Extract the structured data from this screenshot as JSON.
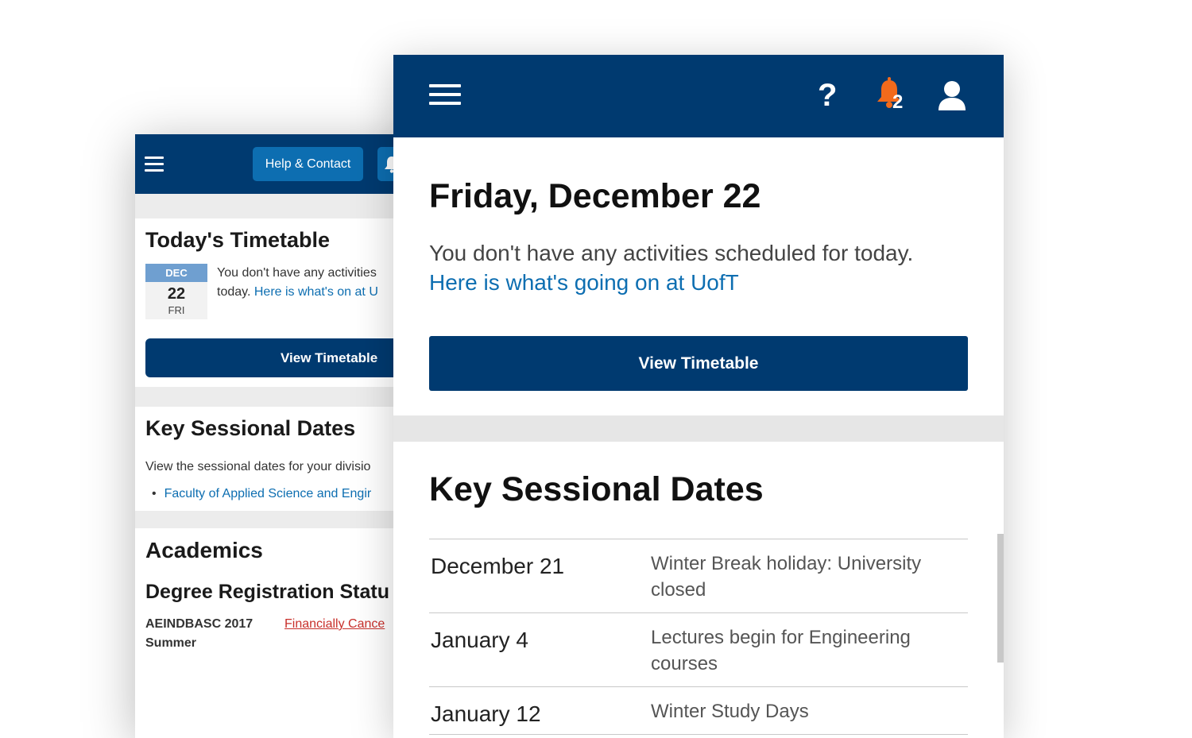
{
  "back_panel": {
    "header": {
      "help_label": "Help & Contact",
      "icons": [
        "menu-icon",
        "bell-icon"
      ]
    },
    "timetable": {
      "title": "Today's Timetable",
      "date": {
        "month": "DEC",
        "day": "22",
        "weekday": "FRI"
      },
      "message_line1": "You don't have any activities",
      "message_line2_prefix": "today.",
      "link": "Here is what's on at U",
      "button": "View Timetable"
    },
    "sessional": {
      "title": "Key Sessional Dates",
      "subtitle": "View the sessional dates for your divisio",
      "link": "Faculty of Applied Science and Engir"
    },
    "academics": {
      "title": "Academics",
      "subtitle": "Degree Registration Statu",
      "program_line1": "AEINDBASC 2017",
      "program_line2": "Summer",
      "status": "Financially Cance"
    }
  },
  "front_panel": {
    "header": {
      "help_label": "?",
      "notification_count": "2",
      "icons": [
        "menu-icon",
        "help-icon",
        "bell-icon",
        "user-icon"
      ],
      "bell_color": "#f26a1b"
    },
    "today": {
      "date_title": "Friday, December 22",
      "message": "You don't have any activities scheduled for today.",
      "link": "Here is what's going on at UofT",
      "button": "View Timetable"
    },
    "sessional": {
      "title": "Key Sessional Dates",
      "rows": [
        {
          "date": "December 21",
          "event": "Winter Break holiday: University closed"
        },
        {
          "date": "January 4",
          "event": "Lectures begin for Engineering courses"
        },
        {
          "date": "January 12",
          "event": "Winter Study Days"
        }
      ]
    }
  },
  "colors": {
    "header_bg": "#003a70",
    "link": "#0d6eb1",
    "help_button": "#0d6eb1",
    "status_red": "#c8302b",
    "date_month_bg": "#6f9fd0"
  }
}
